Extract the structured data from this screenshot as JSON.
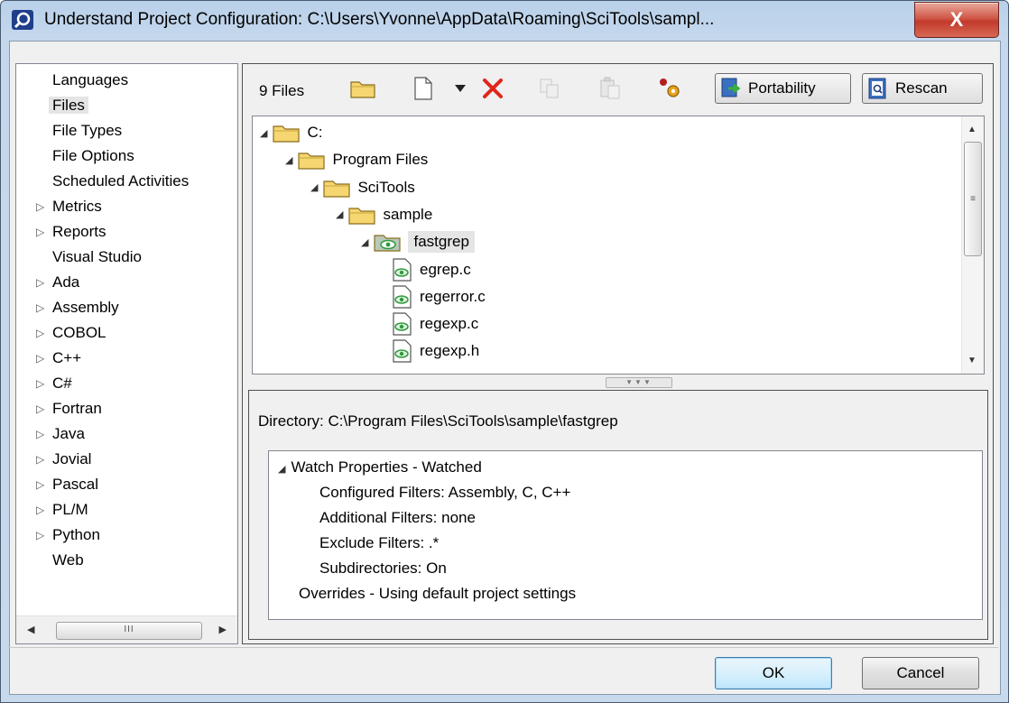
{
  "window": {
    "title": "Understand Project Configuration: C:\\Users\\Yvonne\\AppData\\Roaming\\SciTools\\sampl...",
    "close_label": "X"
  },
  "nav": {
    "items": [
      {
        "label": "Languages",
        "expandable": false,
        "selected": false
      },
      {
        "label": "Files",
        "expandable": false,
        "selected": true
      },
      {
        "label": "File Types",
        "expandable": false,
        "selected": false
      },
      {
        "label": "File Options",
        "expandable": false,
        "selected": false
      },
      {
        "label": "Scheduled Activities",
        "expandable": false,
        "selected": false
      },
      {
        "label": "Metrics",
        "expandable": true,
        "selected": false
      },
      {
        "label": "Reports",
        "expandable": true,
        "selected": false
      },
      {
        "label": "Visual Studio",
        "expandable": false,
        "selected": false
      },
      {
        "label": "Ada",
        "expandable": true,
        "selected": false
      },
      {
        "label": "Assembly",
        "expandable": true,
        "selected": false
      },
      {
        "label": "COBOL",
        "expandable": true,
        "selected": false
      },
      {
        "label": "C++",
        "expandable": true,
        "selected": false
      },
      {
        "label": "C#",
        "expandable": true,
        "selected": false
      },
      {
        "label": "Fortran",
        "expandable": true,
        "selected": false
      },
      {
        "label": "Java",
        "expandable": true,
        "selected": false
      },
      {
        "label": "Jovial",
        "expandable": true,
        "selected": false
      },
      {
        "label": "Pascal",
        "expandable": true,
        "selected": false
      },
      {
        "label": "PL/M",
        "expandable": true,
        "selected": false
      },
      {
        "label": "Python",
        "expandable": true,
        "selected": false
      },
      {
        "label": "Web",
        "expandable": false,
        "selected": false
      }
    ],
    "scroll_grip": "III"
  },
  "toolbar": {
    "files_count": "9 Files",
    "portability_label": "Portability",
    "rescan_label": "Rescan"
  },
  "tree": {
    "nodes": [
      {
        "label": "C:",
        "type": "folder",
        "level": 0
      },
      {
        "label": "Program Files",
        "type": "folder",
        "level": 1
      },
      {
        "label": "SciTools",
        "type": "folder",
        "level": 2
      },
      {
        "label": "sample",
        "type": "folder",
        "level": 3
      },
      {
        "label": "fastgrep",
        "type": "watched-folder",
        "level": 4
      },
      {
        "label": "egrep.c",
        "type": "file",
        "level": 5
      },
      {
        "label": "regerror.c",
        "type": "file",
        "level": 5
      },
      {
        "label": "regexp.c",
        "type": "file",
        "level": 5
      },
      {
        "label": "regexp.h",
        "type": "file",
        "level": 5
      }
    ],
    "scroll_grip": "≡"
  },
  "details": {
    "directory": "Directory: C:\\Program Files\\SciTools\\sample\\fastgrep",
    "watch_header": "Watch Properties - Watched",
    "configured_filters": "Configured Filters: Assembly, C, C++",
    "additional_filters": "Additional Filters: none",
    "exclude_filters": "Exclude Filters: .*",
    "subdirectories": "Subdirectories: On",
    "overrides": "Overrides - Using default project settings"
  },
  "buttons": {
    "ok": "OK",
    "cancel": "Cancel"
  },
  "colors": {
    "close_red": "#c23a2b",
    "folder_yellow": "#f5d670",
    "watched_green": "#2e9a3c",
    "delete_red": "#e0261a"
  }
}
